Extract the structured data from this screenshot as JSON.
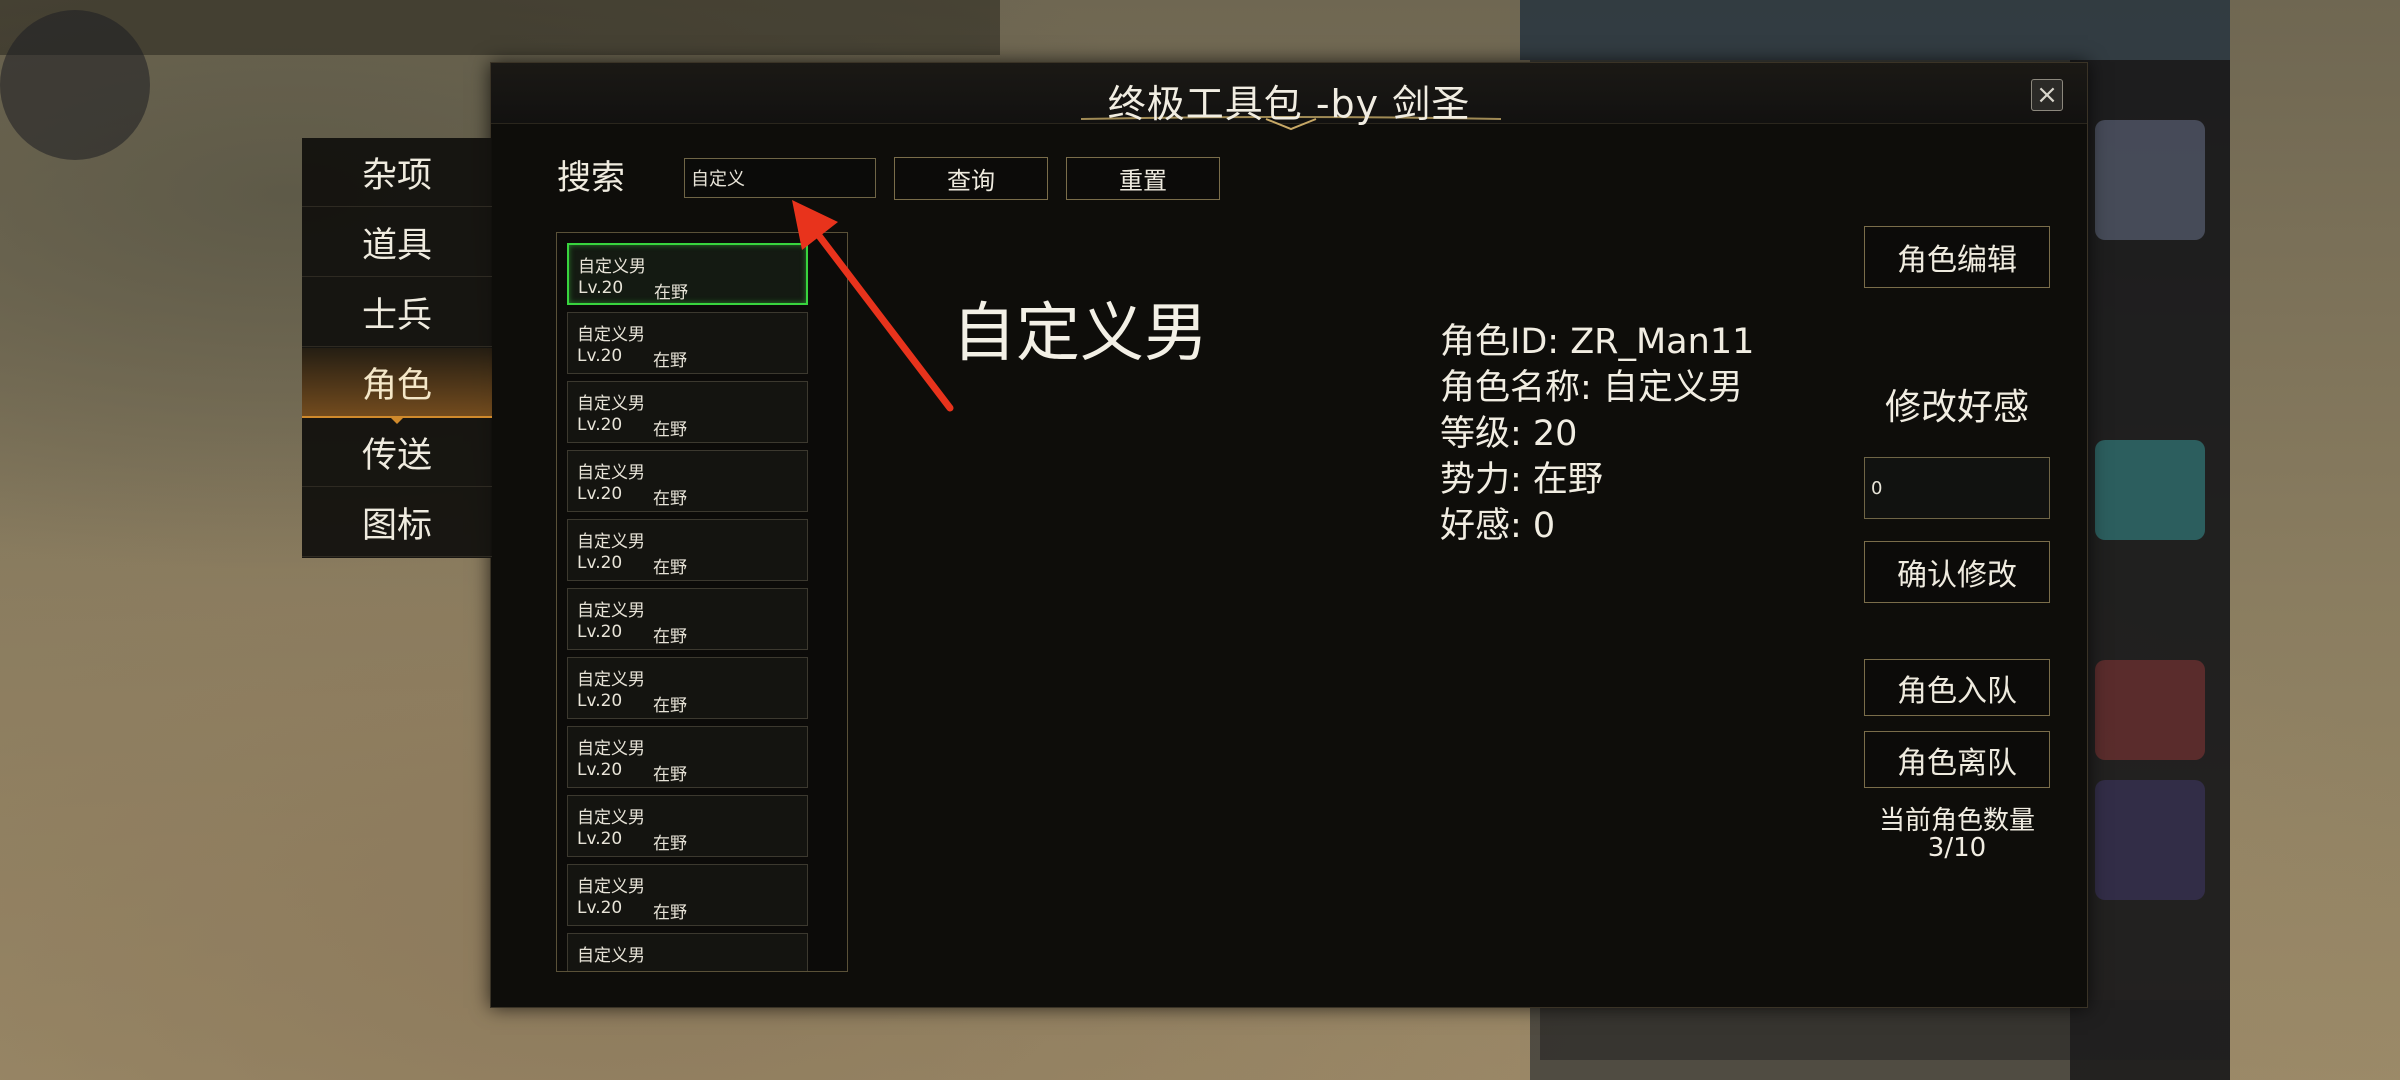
{
  "window": {
    "title": "终极工具包 -by 剑圣",
    "close_symbol": "×"
  },
  "sidebar": {
    "items": [
      {
        "label": "杂项",
        "active": false
      },
      {
        "label": "道具",
        "active": false
      },
      {
        "label": "士兵",
        "active": false
      },
      {
        "label": "角色",
        "active": true
      },
      {
        "label": "传送",
        "active": false
      },
      {
        "label": "图标",
        "active": false
      }
    ]
  },
  "search": {
    "label": "搜索",
    "value": "自定义",
    "query_label": "查询",
    "reset_label": "重置"
  },
  "list": {
    "items": [
      {
        "name": "自定义男",
        "level": "Lv.20",
        "faction": "在野"
      },
      {
        "name": "自定义男",
        "level": "Lv.20",
        "faction": "在野"
      },
      {
        "name": "自定义男",
        "level": "Lv.20",
        "faction": "在野"
      },
      {
        "name": "自定义男",
        "level": "Lv.20",
        "faction": "在野"
      },
      {
        "name": "自定义男",
        "level": "Lv.20",
        "faction": "在野"
      },
      {
        "name": "自定义男",
        "level": "Lv.20",
        "faction": "在野"
      },
      {
        "name": "自定义男",
        "level": "Lv.20",
        "faction": "在野"
      },
      {
        "name": "自定义男",
        "level": "Lv.20",
        "faction": "在野"
      },
      {
        "name": "自定义男",
        "level": "Lv.20",
        "faction": "在野"
      },
      {
        "name": "自定义男",
        "level": "Lv.20",
        "faction": "在野"
      },
      {
        "name": "自定义男",
        "level": "",
        "faction": ""
      }
    ]
  },
  "detail": {
    "name": "自定义男",
    "info": [
      "角色ID: ZR_Man11",
      "角色名称: 自定义男",
      "等级: 20",
      "势力: 在野",
      "好感: 0"
    ]
  },
  "actions": {
    "role_edit": "角色编辑",
    "affinity_heading": "修改好感",
    "affinity_value": "0",
    "confirm": "确认修改",
    "join": "角色入队",
    "leave": "角色离队",
    "count_label": "当前角色数量",
    "count_value": "3/10"
  },
  "colors": {
    "window_bg": "#0e0d0a",
    "accent_gold": "#7a6d4a",
    "active_tab": "#d08a2c",
    "selected_border": "#38d43e",
    "annotation_arrow": "#e8331c"
  }
}
